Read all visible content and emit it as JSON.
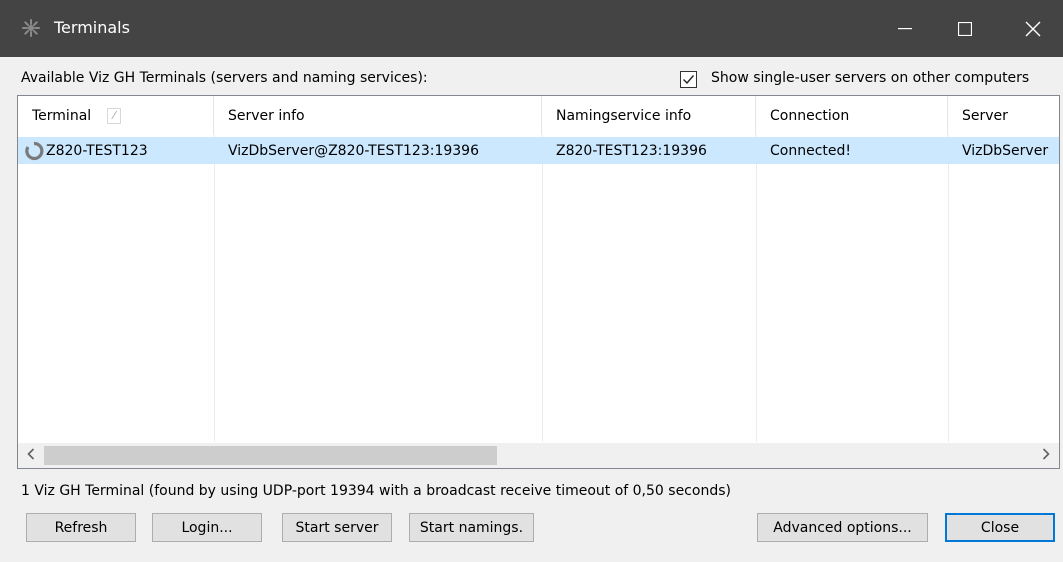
{
  "window": {
    "title": "Terminals",
    "icon": "gear-icon"
  },
  "heading": "Available Viz GH Terminals (servers and naming services):",
  "checkbox": {
    "label": "Show single-user servers on other computers",
    "checked": true
  },
  "table": {
    "columns": [
      "Terminal",
      "Server info",
      "Namingservice info",
      "Connection",
      "Server"
    ],
    "rows": [
      {
        "terminal": "Z820-TEST123",
        "server_info": "VizDbServer@Z820-TEST123:19396",
        "namingservice_info": "Z820-TEST123:19396",
        "connection": "Connected!",
        "server": "VizDbServer",
        "status_icon": "spinner-icon"
      }
    ]
  },
  "status_text": "1 Viz GH Terminal (found by using UDP-port 19394 with a broadcast receive timeout of 0,50 seconds)",
  "buttons": {
    "refresh": "Refresh",
    "login": "Login...",
    "start_server": "Start server",
    "start_namings": "Start namings.",
    "advanced_options": "Advanced options...",
    "close": "Close"
  },
  "colors": {
    "titlebar": "#444444",
    "selection": "#cce8ff",
    "accent": "#0078d7"
  }
}
